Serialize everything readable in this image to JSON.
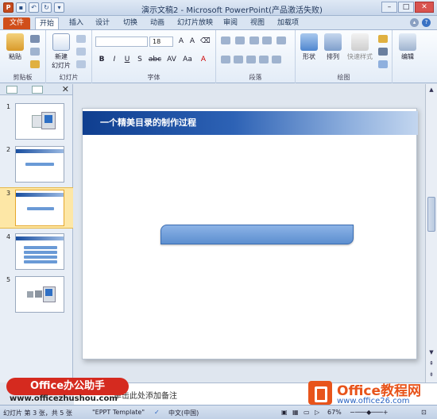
{
  "window": {
    "title": "演示文稿2 - Microsoft PowerPoint(产品激活失败)",
    "qat_icon": "P"
  },
  "tabs": [
    {
      "label": "文件"
    },
    {
      "label": "开始"
    },
    {
      "label": "插入"
    },
    {
      "label": "设计"
    },
    {
      "label": "切换"
    },
    {
      "label": "动画"
    },
    {
      "label": "幻灯片放映"
    },
    {
      "label": "审阅"
    },
    {
      "label": "视图"
    },
    {
      "label": "加载项"
    }
  ],
  "ribbon": {
    "groups": {
      "clipboard": "剪贴板",
      "slides": "幻灯片",
      "font": "字体",
      "paragraph": "段落",
      "drawing": "绘图",
      "editing": ""
    },
    "buttons": {
      "paste": "粘贴",
      "new_slide_line1": "新建",
      "new_slide_line2": "幻灯片",
      "shape": "形状",
      "arrange": "排列",
      "quick_styles": "快速样式",
      "edit": "编辑"
    },
    "font_size": "18",
    "font_format": [
      "B",
      "I",
      "U",
      "S",
      "abc",
      "AV",
      "Aa",
      "A"
    ]
  },
  "slides_panel": {
    "slides": [
      {
        "number": "1"
      },
      {
        "number": "2"
      },
      {
        "number": "3"
      },
      {
        "number": "4"
      },
      {
        "number": "5"
      }
    ]
  },
  "slide": {
    "title": "一个精美目录的制作过程"
  },
  "notes": {
    "text": "单击此处添加备注"
  },
  "statusbar": {
    "slide_info": "幻灯片 第 3 张，共 5 张",
    "theme": "\"EPPT Template\"",
    "language": "中文(中国)",
    "zoom": "67%"
  },
  "watermarks": {
    "left_badge": "Office办公助手",
    "left_url": "www.officezhushou.com",
    "right_title": "Office教程网",
    "right_url": "www.office26.com"
  },
  "colors": {
    "file_tab": "#d04e1a",
    "slide_header": "#0f3e8f",
    "selected_thumb": "#fde7a6"
  }
}
